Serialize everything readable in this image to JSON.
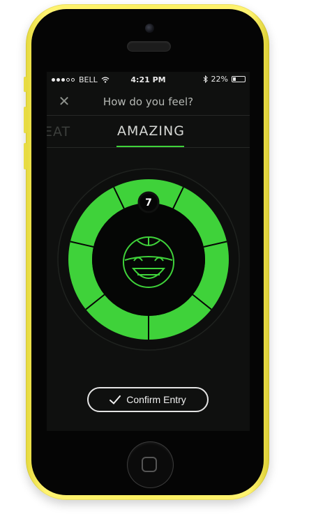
{
  "status_bar": {
    "carrier": "BELL",
    "time": "4:21 PM",
    "battery_percent": "22%",
    "battery_level": 0.22,
    "signal_dots_filled": 3,
    "signal_dots_total": 5
  },
  "header": {
    "title": "How do you feel?",
    "close_icon": "close-icon"
  },
  "tabs": {
    "previous_label": "EAT",
    "active_label": "AMAZING"
  },
  "mood_gauge": {
    "value": "7",
    "segments_total": 7,
    "face_icon": "smiling-face-icon",
    "accent_color": "#3fd23a",
    "ring_color": "#1f2a1f"
  },
  "actions": {
    "confirm_label": "Confirm Entry",
    "confirm_icon": "checkmark-icon"
  },
  "colors": {
    "accent": "#3fd23a",
    "background": "#0f100f",
    "device_body": "#fbf062"
  }
}
